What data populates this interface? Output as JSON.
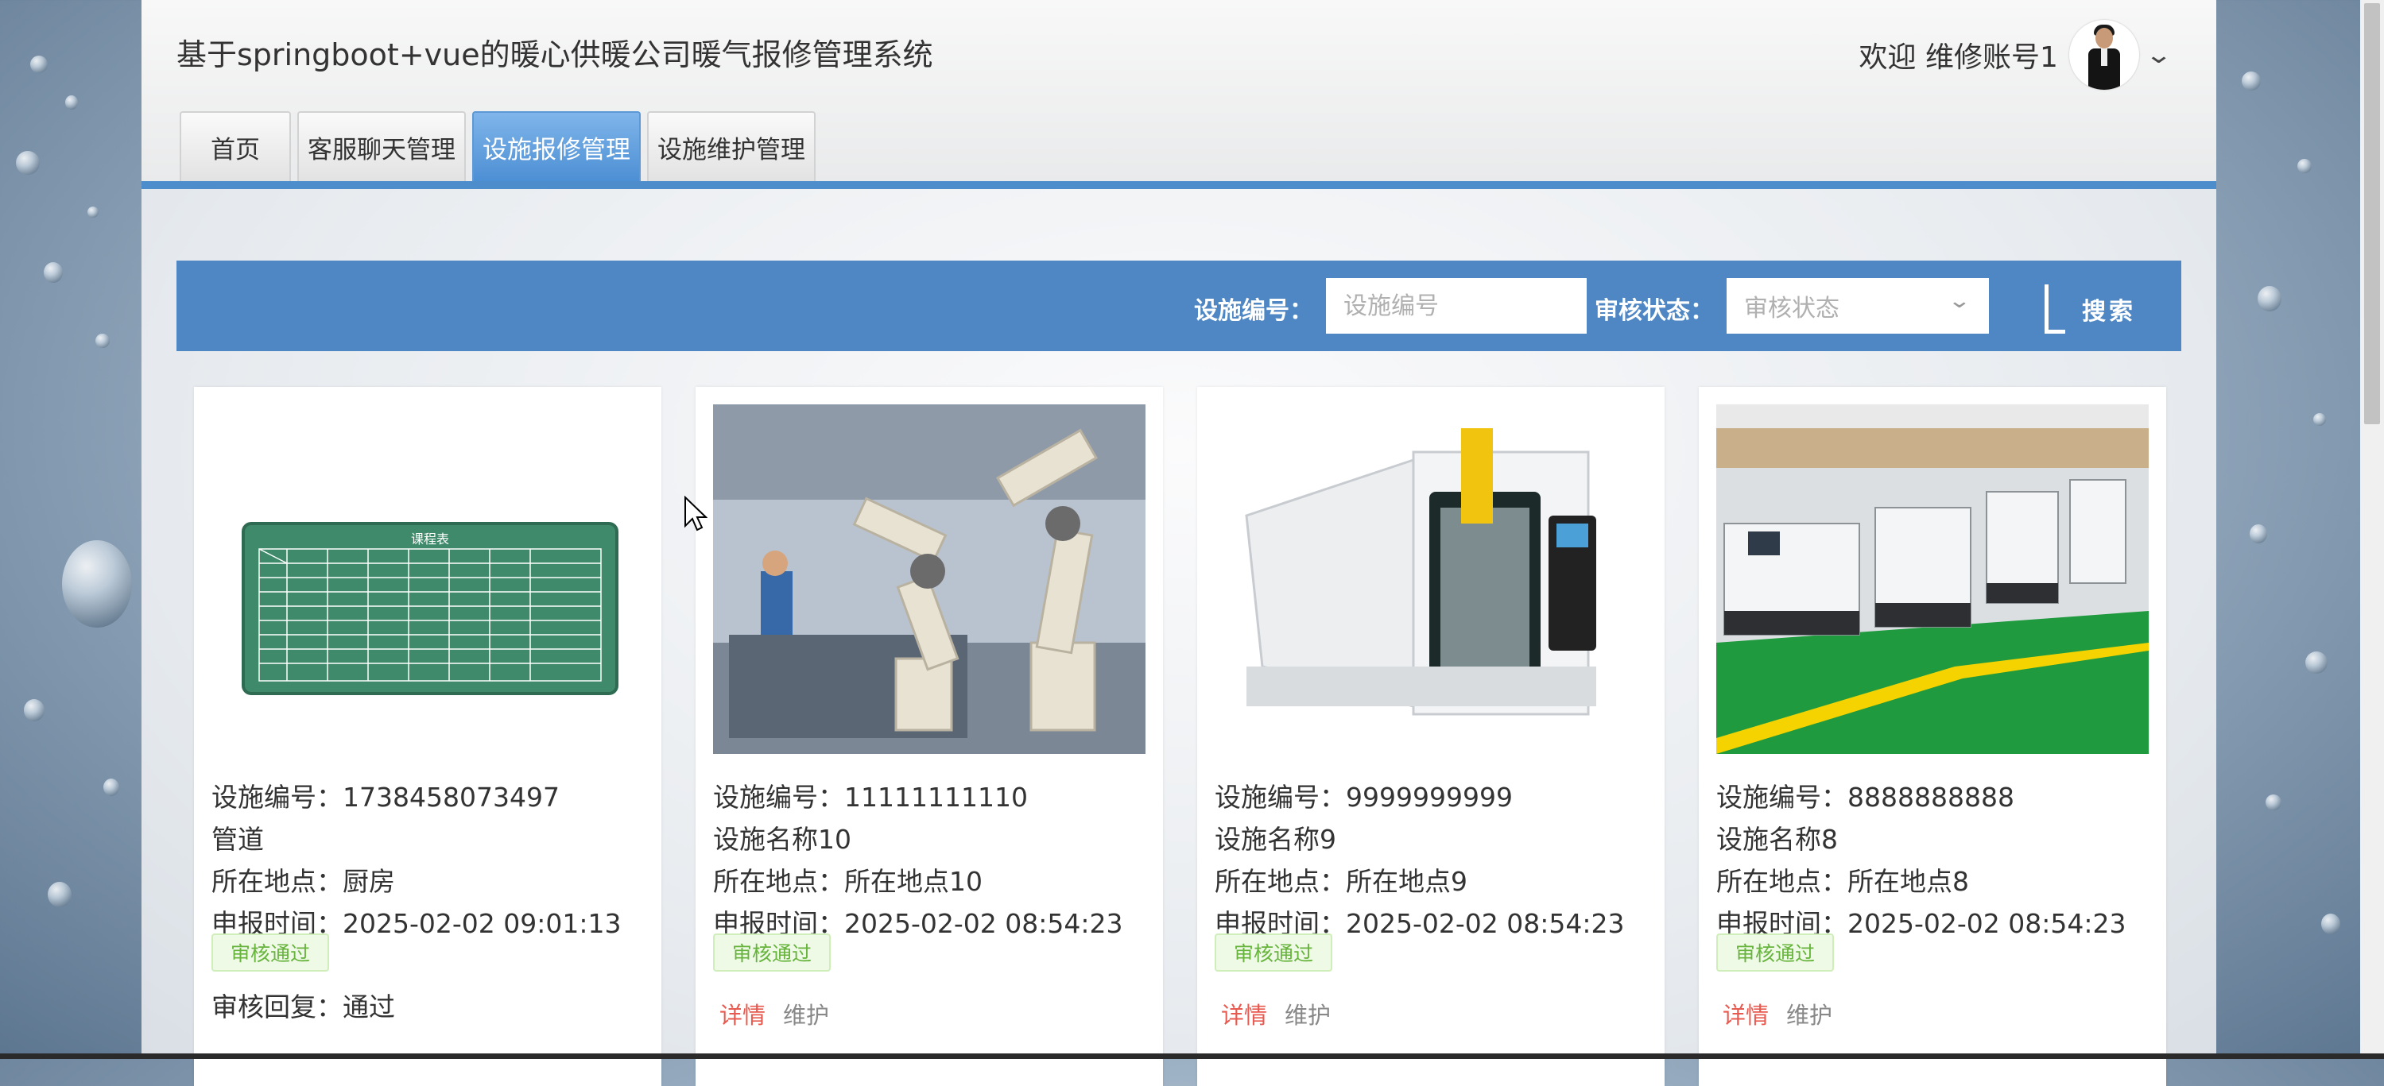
{
  "header": {
    "title": "基于springboot+vue的暖心供暖公司暖气报修管理系统",
    "welcome": "欢迎 维修账号1"
  },
  "tabs": [
    {
      "label": "首页"
    },
    {
      "label": "客服聊天管理"
    },
    {
      "label": "设施报修管理",
      "active": true
    },
    {
      "label": "设施维护管理"
    }
  ],
  "search": {
    "code_label": "设施编号：",
    "code_placeholder": "设施编号",
    "status_label": "审核状态：",
    "status_placeholder": "审核状态",
    "button": "搜索"
  },
  "cards": [
    {
      "code": "设施编号：1738458073497",
      "name": "管道",
      "location": "所在地点：厨房",
      "time": "申报时间：2025-02-02 09:01:13",
      "badge": "审核通过",
      "reply": "审核回复：通过",
      "image_icon": "schedule-board-image"
    },
    {
      "code": "设施编号：11111111110",
      "name": "设施名称10",
      "location": "所在地点：所在地点10",
      "time": "申报时间：2025-02-02 08:54:23",
      "badge": "审核通过",
      "detail": "详情",
      "maintain": "维护",
      "image_icon": "industrial-robot-image"
    },
    {
      "code": "设施编号：9999999999",
      "name": "设施名称9",
      "location": "所在地点：所在地点9",
      "time": "申报时间：2025-02-02 08:54:23",
      "badge": "审核通过",
      "detail": "详情",
      "maintain": "维护",
      "image_icon": "cnc-machine-image"
    },
    {
      "code": "设施编号：8888888888",
      "name": "设施名称8",
      "location": "所在地点：所在地点8",
      "time": "申报时间：2025-02-02 08:54:23",
      "badge": "审核通过",
      "detail": "详情",
      "maintain": "维护",
      "image_icon": "factory-workshop-image"
    }
  ],
  "colors": {
    "accent": "#4f87c4",
    "active_tab": "#5b9ce0",
    "badge_green": "#67b43d",
    "detail_red": "#e85a4f"
  }
}
